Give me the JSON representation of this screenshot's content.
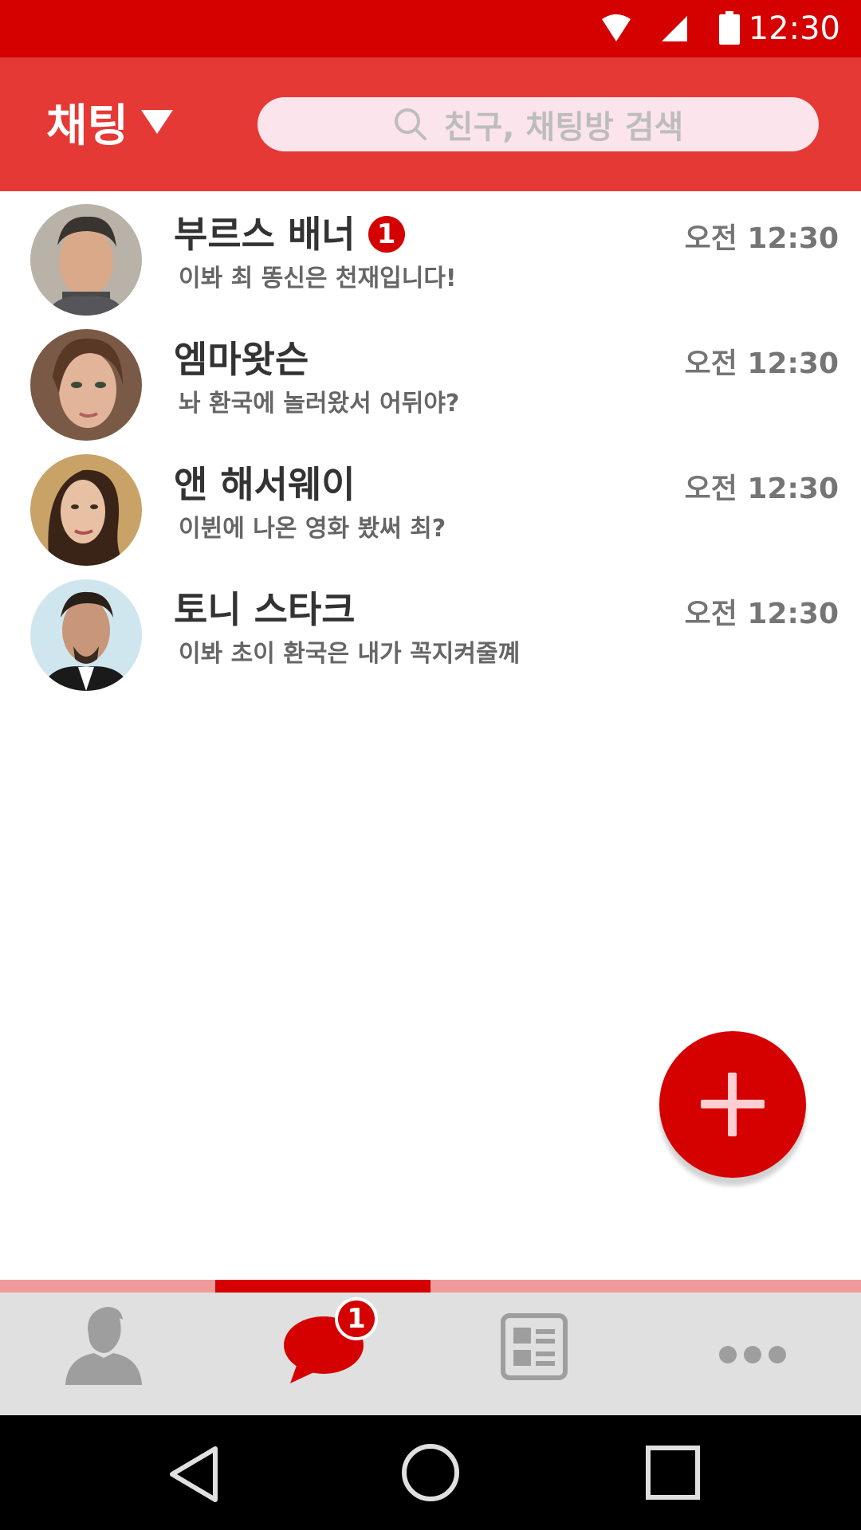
{
  "status_bar": {
    "time": "12:30"
  },
  "app_bar": {
    "title": "채팅",
    "search_placeholder": "친구, 채팅방 검색"
  },
  "chats": [
    {
      "name": "부르스 배너",
      "message": "이봐 최 똥신은 천재입니다!",
      "time": "오전 12:30",
      "unread": "1"
    },
    {
      "name": "엠마왓슨",
      "message": "놔 환국에 놀러왔서 어뒤야?",
      "time": "오전 12:30",
      "unread": null
    },
    {
      "name": "앤 해서웨이",
      "message": "이뷘에 나온 영화 봤써 최?",
      "time": "오전 12:30",
      "unread": null
    },
    {
      "name": "토니 스타크",
      "message": "이봐 초이 환국은 내가 꼭지켜줄꼐",
      "time": "오전 12:30",
      "unread": null
    }
  ],
  "bottom_nav": {
    "chat_badge": "1",
    "tabs": [
      "friends-tab",
      "chats-tab",
      "news-tab",
      "more-tab"
    ]
  },
  "colors": {
    "status_bar": "#d50000",
    "app_bar": "#e53935",
    "accent": "#d50000",
    "search_bg": "#fce4ec",
    "nav_bg": "#e0e0e0"
  }
}
